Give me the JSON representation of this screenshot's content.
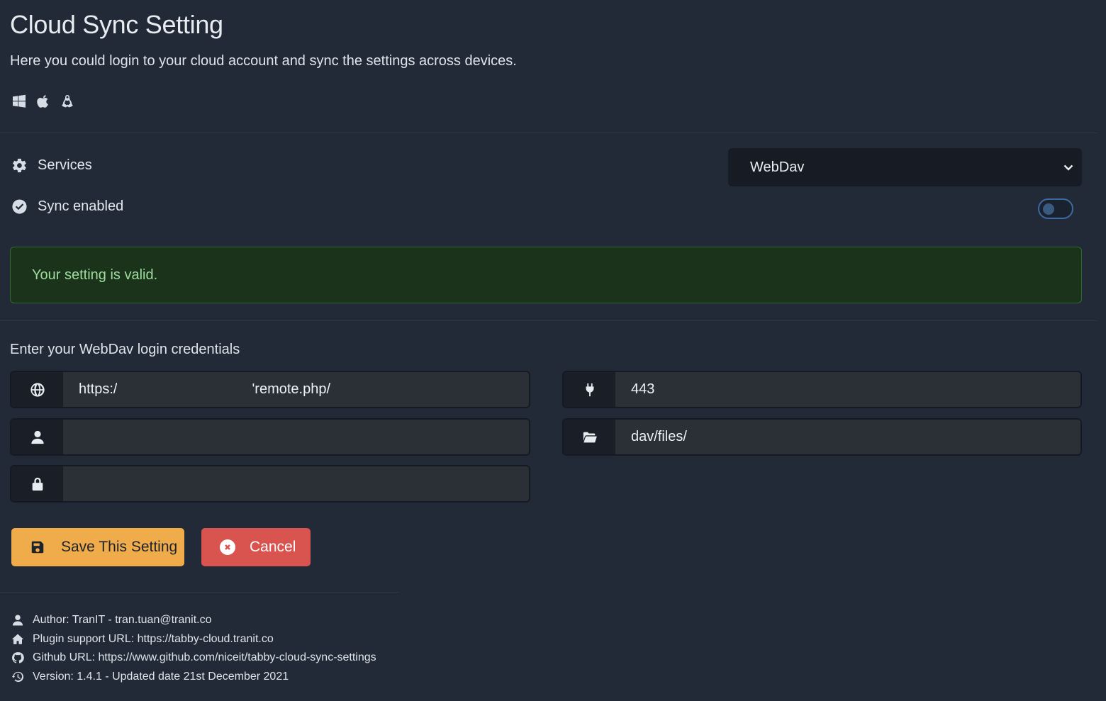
{
  "header": {
    "title": "Cloud Sync Setting",
    "subtitle": "Here you could login to your cloud account and sync the settings across devices.",
    "platform_icons": [
      "windows-icon",
      "apple-icon",
      "linux-icon"
    ]
  },
  "settings": {
    "services_label": "Services",
    "services_selected": "WebDav",
    "sync_label": "Sync enabled",
    "sync_enabled": false
  },
  "alert": {
    "message": "Your setting is valid.",
    "color": "#1b331b"
  },
  "credentials": {
    "section_label": "Enter your WebDav login credentials",
    "url_prefix": "https:/",
    "url_suffix": "'remote.php/",
    "username": "",
    "password": "",
    "port": "443",
    "location": "dav/files/"
  },
  "buttons": {
    "save_label": "Save This Setting",
    "cancel_label": "Cancel",
    "save_color": "#f0ac4b",
    "cancel_color": "#d9534f"
  },
  "footer": {
    "author": "Author: TranIT - tran.tuan@tranit.co",
    "support": "Plugin support URL: https://tabby-cloud.tranit.co",
    "github": "Github URL: https://www.github.com/niceit/tabby-cloud-sync-settings",
    "version": "Version: 1.4.1 - Updated date 21st December 2021"
  }
}
